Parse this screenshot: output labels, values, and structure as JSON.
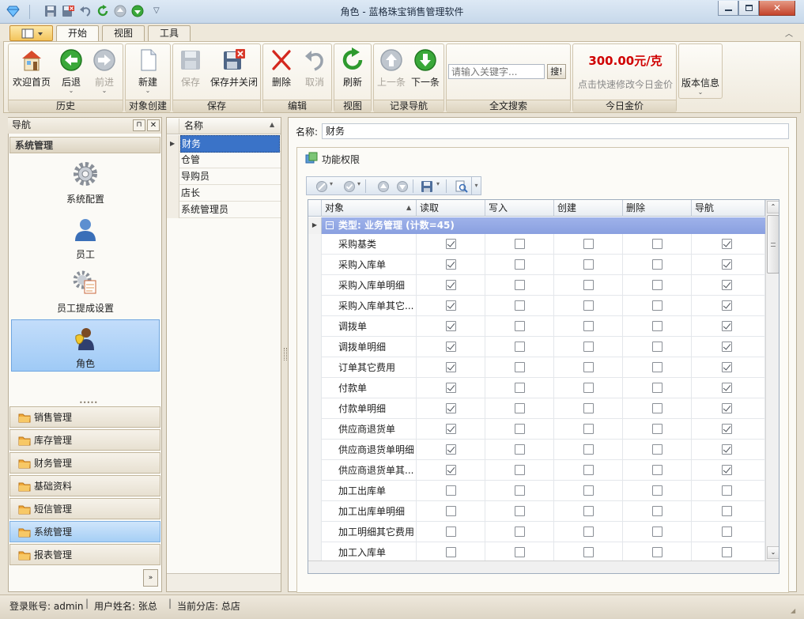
{
  "window": {
    "title": "角色 - 蓝格珠宝销售管理软件"
  },
  "ribbon_tabs": [
    "开始",
    "视图",
    "工具"
  ],
  "ribbon": {
    "groups": [
      "历史",
      "对象创建",
      "保存",
      "编辑",
      "视图",
      "记录导航",
      "全文搜索",
      "今日金价"
    ],
    "buttons": {
      "home": "欢迎首页",
      "back": "后退",
      "forward": "前进",
      "new": "新建",
      "save": "保存",
      "save_close": "保存并关闭",
      "delete": "删除",
      "cancel": "取消",
      "refresh": "刷新",
      "prev": "上一条",
      "next": "下一条",
      "version": "版本信息"
    },
    "search": {
      "placeholder": "请输入关键字...",
      "button": "搜!"
    },
    "gold": {
      "price": "300.00元/克",
      "hint": "点击快速修改今日金价"
    }
  },
  "nav": {
    "title": "导航",
    "section": "系统管理",
    "tiles": [
      "系统配置",
      "员工",
      "员工提成设置",
      "角色"
    ],
    "groups": [
      "销售管理",
      "库存管理",
      "财务管理",
      "基础资料",
      "短信管理",
      "系统管理",
      "报表管理"
    ],
    "selected_group": "系统管理"
  },
  "roles_list": {
    "header": "名称",
    "items": [
      "财务",
      "仓管",
      "导购员",
      "店长",
      "系统管理员"
    ],
    "selected": "财务"
  },
  "detail": {
    "name_label": "名称:",
    "name_value": "财务",
    "permissions_title": "功能权限",
    "columns": [
      "对象",
      "读取",
      "写入",
      "创建",
      "删除",
      "导航"
    ],
    "group_row": "类型: 业务管理 (计数=45)",
    "rows": [
      {
        "object": "采购基类",
        "read": true,
        "write": false,
        "create": false,
        "delete": false,
        "nav": true
      },
      {
        "object": "采购入库单",
        "read": true,
        "write": false,
        "create": false,
        "delete": false,
        "nav": true
      },
      {
        "object": "采购入库单明细",
        "read": true,
        "write": false,
        "create": false,
        "delete": false,
        "nav": true
      },
      {
        "object": "采购入库单其它...",
        "read": true,
        "write": false,
        "create": false,
        "delete": false,
        "nav": true
      },
      {
        "object": "调拨单",
        "read": true,
        "write": false,
        "create": false,
        "delete": false,
        "nav": true
      },
      {
        "object": "调拨单明细",
        "read": true,
        "write": false,
        "create": false,
        "delete": false,
        "nav": true
      },
      {
        "object": "订单其它费用",
        "read": true,
        "write": false,
        "create": false,
        "delete": false,
        "nav": true
      },
      {
        "object": "付款单",
        "read": true,
        "write": false,
        "create": false,
        "delete": false,
        "nav": true
      },
      {
        "object": "付款单明细",
        "read": true,
        "write": false,
        "create": false,
        "delete": false,
        "nav": true
      },
      {
        "object": "供应商退货单",
        "read": true,
        "write": false,
        "create": false,
        "delete": false,
        "nav": true
      },
      {
        "object": "供应商退货单明细",
        "read": true,
        "write": false,
        "create": false,
        "delete": false,
        "nav": true
      },
      {
        "object": "供应商退货单其...",
        "read": true,
        "write": false,
        "create": false,
        "delete": false,
        "nav": true
      },
      {
        "object": "加工出库单",
        "read": false,
        "write": false,
        "create": false,
        "delete": false,
        "nav": false
      },
      {
        "object": "加工出库单明细",
        "read": false,
        "write": false,
        "create": false,
        "delete": false,
        "nav": false
      },
      {
        "object": "加工明细其它费用",
        "read": false,
        "write": false,
        "create": false,
        "delete": false,
        "nav": false
      },
      {
        "object": "加工入库单",
        "read": false,
        "write": false,
        "create": false,
        "delete": false,
        "nav": false
      }
    ]
  },
  "status": {
    "account": "登录账号: admin",
    "user": "用户姓名: 张总",
    "branch": "当前分店: 总店"
  },
  "colors": {
    "accent_blue": "#3a73c8",
    "group_row": "#8aa0e0",
    "gold_price": "#d00000",
    "selected_tile": "#9fcaf6"
  }
}
